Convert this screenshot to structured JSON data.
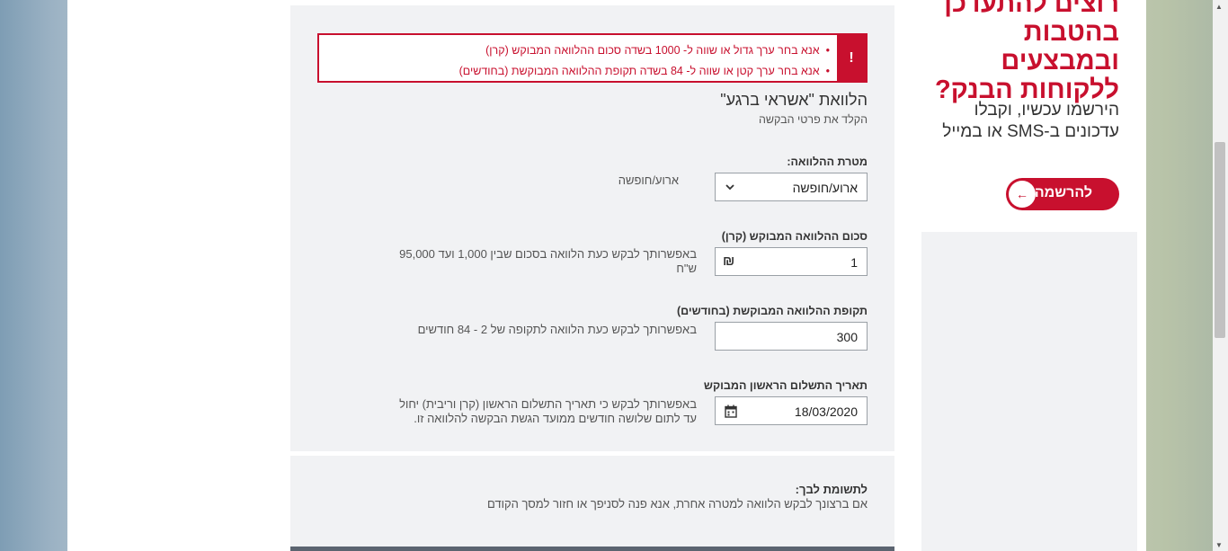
{
  "errors": [
    "אנא בחר ערך גדול או שווה ל- 1000 בשדה סכום ההלוואה המבוקש (קרן)",
    "אנא בחר ערך קטן או שווה ל- 84 בשדה תקופת ההלוואה המבוקשת (בחודשים)"
  ],
  "error_mark": "!",
  "form": {
    "title": "הלוואת \"אשראי ברגע\"",
    "subtitle": "הקלד את פרטי הבקשה",
    "purpose": {
      "label": "מטרת ההלוואה:",
      "selected": "ארוע/חופשה",
      "help": "ארוע/חופשה"
    },
    "amount": {
      "label": "סכום ההלוואה המבוקש (קרן)",
      "value": "1",
      "currency_symbol": "₪",
      "help": "באפשרותך לבקש כעת הלוואה בסכום שבין 1,000 ועד 95,000 ש\"ח"
    },
    "period": {
      "label": "תקופת ההלוואה המבוקשת (בחודשים)",
      "value": "300",
      "help": "באפשרותך לבקש כעת הלוואה לתקופה של 2 - 84 חודשים"
    },
    "first_payment": {
      "label": "תאריך התשלום הראשון המבוקש",
      "value": "18/03/2020",
      "help": "באפשרותך לבקש כי תאריך התשלום הראשון (קרן וריבית) יחול עד לתום שלושה חודשים ממועד הגשת הבקשה להלוואה זו."
    }
  },
  "reply": {
    "title": "לתשומת לבך:",
    "text": "אם ברצונך לבקש הלוואה למטרה אחרת, אנא פנה לסניפך או חזור למסך הקודם"
  },
  "promo": {
    "headline_lines": [
      "רוצים להתעדכן",
      "בהטבות",
      "ובמבצעים",
      "ללקוחות הבנק?"
    ],
    "sub_lines": [
      "הירשמו עכשיו, וקבלו",
      "עדכונים ב-SMS או במייל"
    ],
    "register_label": "להרשמה",
    "register_arrow": "←"
  },
  "colors": {
    "accent": "#c8102e",
    "panel": "#f1f2f4"
  },
  "icons": {
    "currency": "shekel-icon",
    "calendar": "calendar-icon",
    "dropdown": "chevron-down-icon"
  }
}
